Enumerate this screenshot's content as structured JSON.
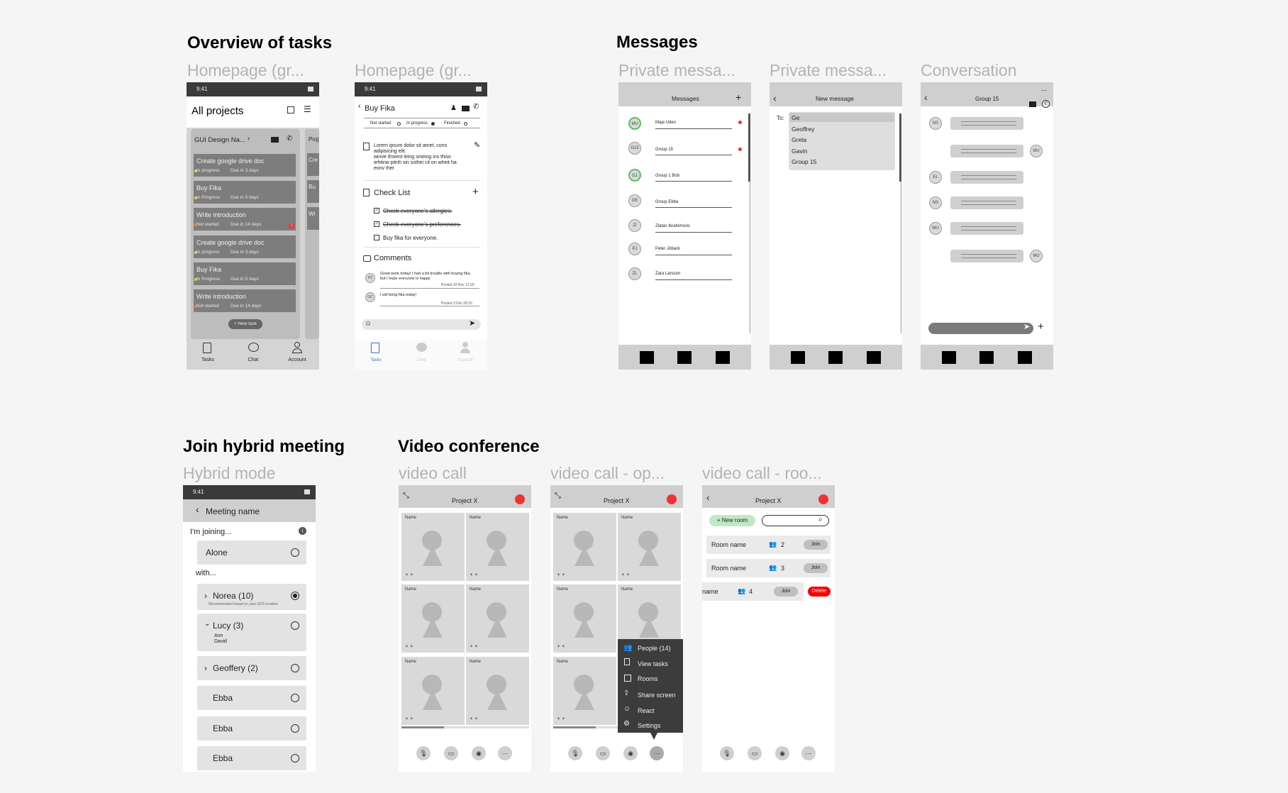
{
  "sections": {
    "overview": "Overview of tasks",
    "messages": "Messages",
    "join": "Join hybrid meeting",
    "video": "Video conference"
  },
  "frame_labels": {
    "home1": "Homepage (gr...",
    "home2": "Homepage (gr...",
    "pm1": "Private messa...",
    "pm2": "Private messa...",
    "conv": "Conversation",
    "hybrid": "Hybrid mode",
    "vc1": "video call",
    "vc2": "video call - op...",
    "vc3": "video call - roo..."
  },
  "status_time": "9:41",
  "home1": {
    "title": "All projects",
    "card_title": "GUI Design Na...",
    "card2": "Proj",
    "tasks": [
      {
        "title": "Create google drive doc",
        "status": "In progress",
        "due": "Due in 3 days"
      },
      {
        "title": "Buy Fika",
        "status": "In Progress",
        "due": "Due in 5 days"
      },
      {
        "title": "Write introduction",
        "status": "Not started",
        "due": "Due in 14 days",
        "badge": "1"
      },
      {
        "title": "Create google drive doc",
        "status": "In progress",
        "due": "Due in 3 days"
      },
      {
        "title": "Buy Fika",
        "status": "In Progress",
        "due": "Due in 5 days"
      },
      {
        "title": "Write introduction",
        "status": "Not started",
        "due": "Due in 14 days"
      }
    ],
    "peek": [
      "Cre",
      "Bu",
      "Wr"
    ],
    "new_task": "+ New task",
    "nav": [
      "Tasks",
      "Chat",
      "Account"
    ]
  },
  "home2": {
    "title": "Buy Fika",
    "status_opts": [
      "Not started",
      "In progress",
      "Finished"
    ],
    "desc": [
      "Lorem ipsum dolor sit amet, cons",
      "adipisicing elit.",
      "winve thsient leing sineing ins thiso",
      "iehtinw pitnh sin ssthei cit on wheit ha",
      "eonv thei"
    ],
    "checklist_title": "Check List",
    "checklist": [
      "Check everyone's allergies.",
      "Check everyone's preferences.",
      "Buy fika for everyone."
    ],
    "comments_title": "Comments",
    "comments": [
      {
        "init": "PZ",
        "text1": "Great work today! I had a bit trouble with buying fika,",
        "text2": "but I hope everyone is happy",
        "posted": "Posted 29 Nov 12:20"
      },
      {
        "init": "GC",
        "text1": "I will bring fika today!",
        "text2": "",
        "posted": "Posted 3 Dec 09:15"
      }
    ],
    "nav": [
      "Tasks",
      "Chat",
      "Account"
    ]
  },
  "pm1": {
    "title": "Messages",
    "add": "+",
    "items": [
      {
        "init": "MU",
        "name": "Maja Uden",
        "unread": true
      },
      {
        "init": "G15",
        "name": "Group 15",
        "unread": true
      },
      {
        "init": "G1",
        "name": "Group 1 Bob",
        "unread": false
      },
      {
        "init": "GE",
        "name": "Group Ebba",
        "unread": false
      },
      {
        "init": "ZI",
        "name": "Zlatan Ibrahimovic",
        "unread": false
      },
      {
        "init": "PJ",
        "name": "Peter Jöback",
        "unread": false
      },
      {
        "init": "ZL",
        "name": "Zara Larsson",
        "unread": false
      }
    ]
  },
  "pm2": {
    "title": "New message",
    "to": "To:",
    "query": "Ge",
    "suggestions": [
      "Geoffrey",
      "Greta",
      "Gavin",
      "Group 15"
    ]
  },
  "conv": {
    "title": "Group 15",
    "more": "...",
    "rows": [
      {
        "init": "NS",
        "side": "left"
      },
      {
        "init": "MU",
        "side": "right"
      },
      {
        "init": "EL",
        "side": "left"
      },
      {
        "init": "NS",
        "side": "left"
      },
      {
        "init": "MU",
        "side": "left"
      },
      {
        "init": "MU",
        "side": "right"
      }
    ],
    "plus": "+"
  },
  "hybrid": {
    "meeting": "Meeting name",
    "joining": "I'm joining...",
    "alone": "Alone",
    "with": "with...",
    "groups": [
      {
        "name": "Norea (10)",
        "note": "Recommended based on your GPS location",
        "selected": true,
        "expanded": false
      },
      {
        "name": "Lucy  (3)",
        "members": [
          "Ann",
          "David"
        ],
        "selected": false,
        "expanded": true
      },
      {
        "name": "Geoffery  (2)",
        "selected": false,
        "expanded": false
      },
      {
        "name": "Ebba",
        "selected": false
      },
      {
        "name": "Ebba",
        "selected": false
      },
      {
        "name": "Ebba",
        "selected": false
      }
    ]
  },
  "vc": {
    "title": "Project X",
    "name": "Name",
    "mic": "✶ ✶",
    "menu": [
      "People (14)",
      "View tasks",
      "Rooms",
      "Share screen",
      "React",
      "Settings"
    ],
    "new_room": "+ New room",
    "rooms": [
      {
        "name": "Room name",
        "count": "2",
        "join": "Join"
      },
      {
        "name": "Room name",
        "count": "3",
        "join": "Join"
      },
      {
        "name": "name",
        "count": "4",
        "join": "Join",
        "delete": "Delete"
      }
    ]
  }
}
